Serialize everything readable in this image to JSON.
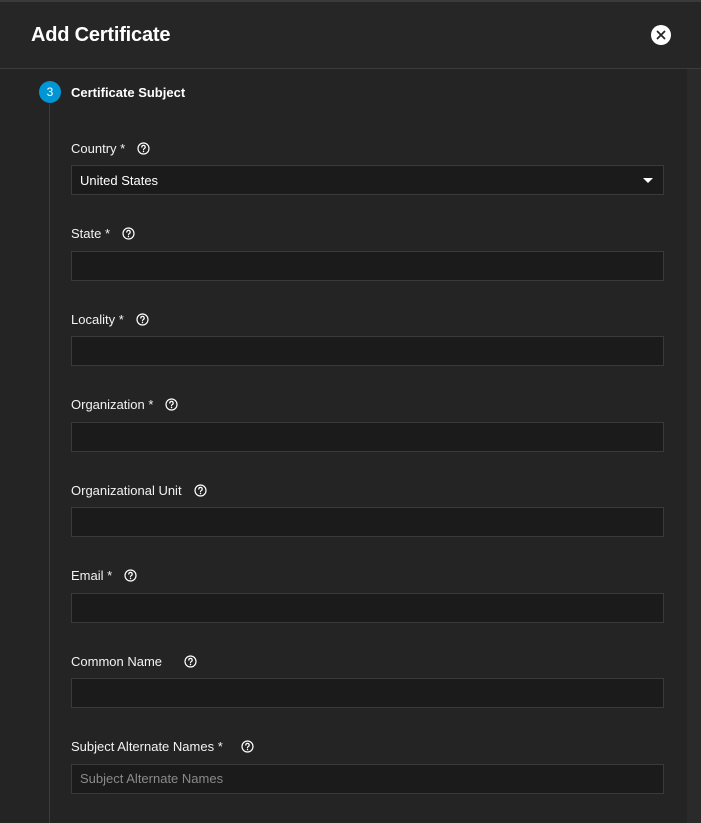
{
  "dialog": {
    "title": "Add Certificate"
  },
  "step": {
    "number": "3",
    "label": "Certificate Subject"
  },
  "fields": {
    "country": {
      "label": "Country *",
      "value": "United States"
    },
    "state": {
      "label": "State *",
      "value": ""
    },
    "locality": {
      "label": "Locality *",
      "value": ""
    },
    "organization": {
      "label": "Organization *",
      "value": ""
    },
    "organizational_unit": {
      "label": "Organizational Unit",
      "value": ""
    },
    "email": {
      "label": "Email *",
      "value": ""
    },
    "common_name": {
      "label": "Common Name",
      "value": ""
    },
    "san": {
      "label": "Subject Alternate Names *",
      "value": "",
      "placeholder": "Subject Alternate Names"
    }
  },
  "colors": {
    "step_accent": "#0095d5",
    "background": "#242424",
    "input_background": "#1b1b1b"
  }
}
